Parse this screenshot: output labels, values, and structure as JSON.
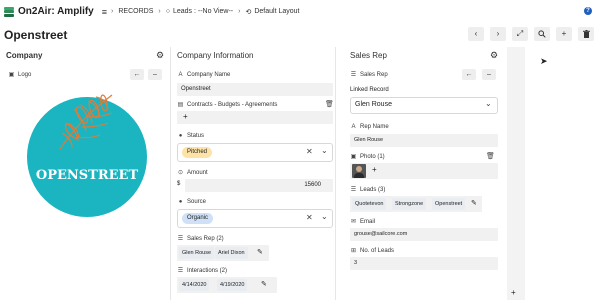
{
  "app": {
    "name": "On2Air: Amplify",
    "breadcrumb": [
      "RECORDS",
      "Leads : --No View--",
      "Default Layout"
    ],
    "help": "?"
  },
  "record": {
    "title": "Openstreet",
    "toolbar": [
      "‹",
      "›",
      "⤢",
      "🔍",
      "+",
      "🗑"
    ]
  },
  "company_panel": {
    "heading": "Company",
    "logo_label": "Logo",
    "logo_text": "OPENSTREET",
    "colors": {
      "circle": "#1ab5c1",
      "leaf": "#e07b39"
    }
  },
  "info_panel": {
    "heading": "Company Information",
    "fields": {
      "company_name": {
        "label": "Company Name",
        "value": "Openstreet"
      },
      "contracts": {
        "label": "Contracts - Budgets - Agreements",
        "add": "+"
      },
      "status": {
        "label": "Status",
        "value": "Pitched",
        "color": "#fde3a7"
      },
      "amount": {
        "label": "Amount",
        "prefix": "$",
        "value": "15600"
      },
      "source": {
        "label": "Source",
        "value": "Organic",
        "color": "#cfe0f7"
      },
      "sales_rep": {
        "label": "Sales Rep (2)",
        "chips": [
          "Glen Rouse",
          "Ariel Dixon"
        ]
      },
      "interactions": {
        "label": "Interactions (2)",
        "chips": [
          "4/14/2020",
          "4/19/2020"
        ]
      }
    }
  },
  "sales_panel": {
    "heading": "Sales Rep",
    "sub_heading": "Sales Rep",
    "linked_label": "Linked Record",
    "linked_value": "Glen Rouse",
    "fields": {
      "rep_name": {
        "label": "Rep Name",
        "value": "Glen Rouse"
      },
      "photo": {
        "label": "Photo (1)",
        "add": "+"
      },
      "leads": {
        "label": "Leads (3)",
        "chips": [
          "Quotetevon",
          "Strongzone",
          "Openstreet"
        ]
      },
      "email": {
        "label": "Email",
        "value": "grouse@sailcore.com"
      },
      "no_of_leads": {
        "label": "No. of Leads",
        "value": "3"
      }
    }
  },
  "right_strip": {
    "add": "+"
  }
}
